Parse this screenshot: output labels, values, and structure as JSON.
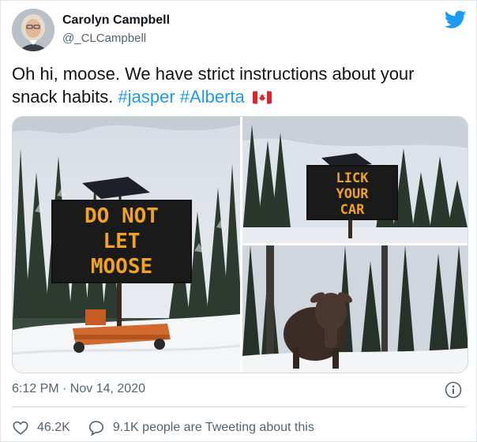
{
  "user": {
    "name": "Carolyn Campbell",
    "handle": "@_CLCampbell"
  },
  "tweet": {
    "text_before": "Oh hi, moose. We have strict instructions about your snack habits. ",
    "hashtag1": "#jasper",
    "hashtag2": "#Alberta",
    "flag_icon": "canada-flag-icon"
  },
  "media": {
    "sign1_lines": [
      "DO NOT",
      "LET",
      "MOOSE"
    ],
    "sign2_lines": [
      "LICK",
      "YOUR",
      "CAR"
    ]
  },
  "meta": {
    "timestamp": "6:12 PM · Nov 14, 2020"
  },
  "actions": {
    "likes": "46.2K",
    "talking": "9.1K people are Tweeting about this"
  },
  "colors": {
    "accent": "#1d9bf0",
    "text": "#0f1419",
    "muted": "#536471",
    "sign_led": "#f0a41a"
  }
}
